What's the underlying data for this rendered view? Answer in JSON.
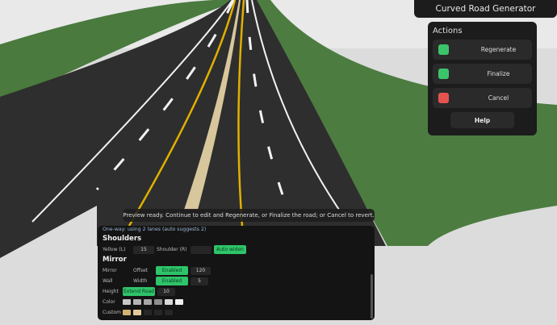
{
  "window": {
    "title": "Curved Road Generator"
  },
  "actions": {
    "heading": "Actions",
    "buttons": [
      {
        "label": "Regenerate",
        "color": "#3cc46a"
      },
      {
        "label": "Finalize",
        "color": "#3cc46a"
      },
      {
        "label": "Cancel",
        "color": "#e5534f"
      }
    ],
    "help_label": "Help"
  },
  "toast": "Preview ready. Continue to edit and Regenerate, or Finalize the road; or Cancel to revert.",
  "panel": {
    "note": "One-way: using 2 lanes (auto suggests 2)",
    "shoulders": {
      "title": "Shoulders",
      "yellow_label": "Yellow (L)",
      "yellow_value": "15",
      "shoulder_label": "Shoulder (R)",
      "shoulder_value": "",
      "auto_widen": "Auto widen"
    },
    "mirror": {
      "title": "Mirror",
      "mirror_label": "Mirror",
      "offset_label": "Offset",
      "offset_toggle": "Enabled",
      "offset_value": "120",
      "wall_label": "Wall",
      "width_label": "Width",
      "width_toggle": "Enabled",
      "width_value": "5",
      "height_label": "Height",
      "extend_road": "Extend Road",
      "height_value": "10",
      "color_label": "Color",
      "colors": [
        "#c8c8c8",
        "#b4b4b4",
        "#a6a6a6",
        "#8e8e8e",
        "#d8d8d8",
        "#f0f0f0"
      ],
      "custom_label": "Custom",
      "custom_colors": [
        "#d2b26e",
        "#e3c99a",
        "#262626",
        "#262626",
        "#262626"
      ]
    }
  }
}
